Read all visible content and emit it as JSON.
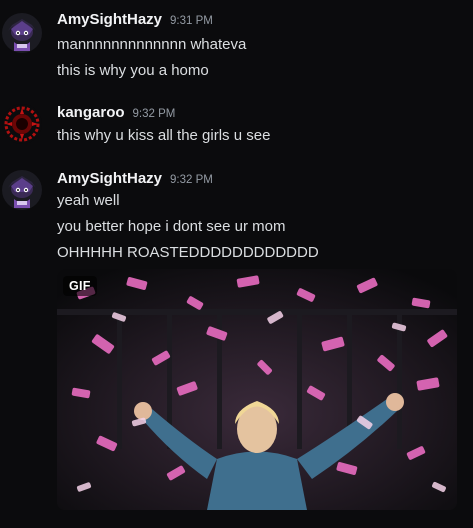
{
  "messages": [
    {
      "username": "AmySightHazy",
      "timestamp": "9:31 PM",
      "avatar": "amy-avatar",
      "lines": [
        "mannnnnnnnnnnnn whateva",
        "this is why you a homo"
      ]
    },
    {
      "username": "kangaroo",
      "timestamp": "9:32 PM",
      "avatar": "kangaroo-avatar",
      "lines": [
        "this why u kiss all the girls u see"
      ]
    },
    {
      "username": "AmySightHazy",
      "timestamp": "9:32 PM",
      "avatar": "amy-avatar",
      "lines": [
        "yeah well",
        "you better hope i dont see ur mom",
        "OHHHHH ROASTEDDDDDDDDDDDD"
      ]
    }
  ],
  "gif": {
    "badge": "GIF",
    "description_icon": "celebration-confetti-gif"
  },
  "colors": {
    "background": "#0b0b0d",
    "username": "#f2f3f5",
    "timestamp": "#949ba4",
    "text": "#dbdee1",
    "confetti": "#e86cc0"
  }
}
